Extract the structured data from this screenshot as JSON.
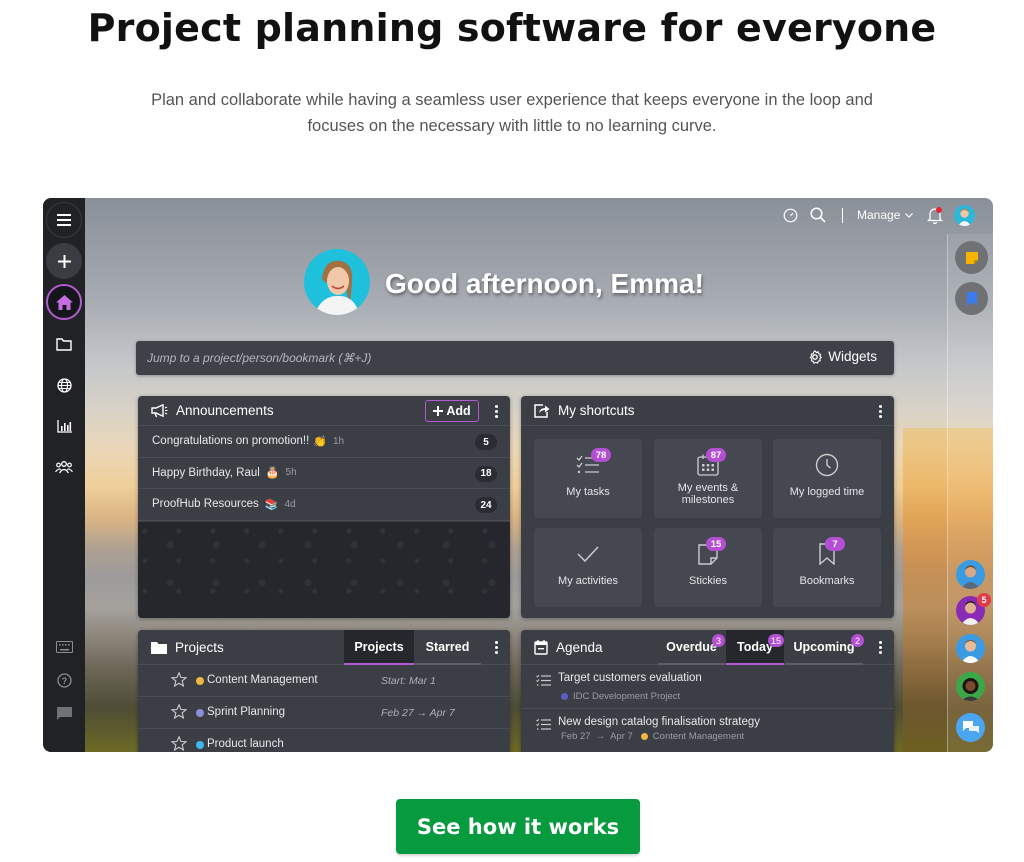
{
  "hero": {
    "title": "Project planning software for everyone",
    "subtitle_line1": "Plan and collaborate while having a seamless user experience that keeps everyone in the loop and",
    "subtitle_line2": "focuses on the necessary with little to no learning curve."
  },
  "app": {
    "topbar": {
      "timer_icon": "timer-icon",
      "search_icon": "search-icon",
      "manage_label": "Manage",
      "notifications_icon": "bell-icon",
      "has_notification": true
    },
    "leftbar": {
      "items": [
        {
          "name": "menu",
          "icon": "hamburger-icon"
        },
        {
          "name": "add",
          "icon": "plus-icon"
        },
        {
          "name": "home",
          "icon": "home-icon",
          "active": true
        },
        {
          "name": "projects",
          "icon": "folder-icon"
        },
        {
          "name": "global",
          "icon": "globe-icon"
        },
        {
          "name": "reports",
          "icon": "chart-icon"
        },
        {
          "name": "people",
          "icon": "people-icon"
        },
        {
          "name": "keyboard-shortcuts",
          "icon": "keyboard-icon"
        },
        {
          "name": "help",
          "icon": "help-icon"
        },
        {
          "name": "feedback",
          "icon": "chat-icon"
        }
      ]
    },
    "greeting": "Good afternoon, Emma!",
    "jump": {
      "placeholder": "Jump to a project/person/bookmark (⌘+J)",
      "widgets_label": "Widgets"
    },
    "announcements": {
      "title": "Announcements",
      "add_label": "Add",
      "items": [
        {
          "text": "Congratulations on promotion!!",
          "emoji": "👏",
          "time": "1h",
          "count": "5"
        },
        {
          "text": "Happy Birthday, Raul",
          "emoji": "🎂",
          "time": "5h",
          "count": "18"
        },
        {
          "text": "ProofHub Resources",
          "emoji": "📚",
          "time": "4d",
          "count": "24"
        }
      ]
    },
    "shortcuts": {
      "title": "My shortcuts",
      "tiles": [
        {
          "label": "My tasks",
          "badge": "78",
          "icon": "checklist-icon"
        },
        {
          "label": "My events & milestones",
          "badge": "87",
          "icon": "calendar-icon"
        },
        {
          "label": "My logged time",
          "badge": "",
          "icon": "clock-icon"
        },
        {
          "label": "My activities",
          "badge": "",
          "icon": "check-icon"
        },
        {
          "label": "Stickies",
          "badge": "15",
          "icon": "sticky-note-icon"
        },
        {
          "label": "Bookmarks",
          "badge": "7",
          "icon": "bookmark-icon"
        }
      ]
    },
    "projects": {
      "title": "Projects",
      "tabs": [
        {
          "label": "Projects",
          "active": true
        },
        {
          "label": "Starred",
          "active": false
        }
      ],
      "rows": [
        {
          "name": "Content Management",
          "color": "#f0b840",
          "date": "Start: Mar 1"
        },
        {
          "name": "Sprint Planning",
          "color": "#8a8fd8",
          "date_start": "Feb 27",
          "date_end": "Apr 7"
        },
        {
          "name": "Product launch",
          "color": "#3db8f0",
          "date": ""
        }
      ]
    },
    "agenda": {
      "title": "Agenda",
      "tabs": [
        {
          "label": "Overdue",
          "badge": "3",
          "active": false
        },
        {
          "label": "Today",
          "badge": "15",
          "active": true
        },
        {
          "label": "Upcoming",
          "badge": "2",
          "active": false
        }
      ],
      "items": [
        {
          "title": "Target customers evaluation",
          "project": "IDC Development Project",
          "project_color": "#5a5fc8"
        },
        {
          "title": "New design catalog finalisation strategy",
          "date_start": "Feb 27",
          "date_end": "Apr 7",
          "project": "Content Management",
          "project_color": "#f0b840"
        }
      ]
    },
    "rightbar": {
      "stickies_icon": "sticky-note-icon",
      "bookmarks_icon": "bookmark-icon",
      "chat_badge": "5",
      "chat_icon": "chat-bubbles-icon"
    }
  },
  "cta": {
    "label": "See how it works"
  }
}
